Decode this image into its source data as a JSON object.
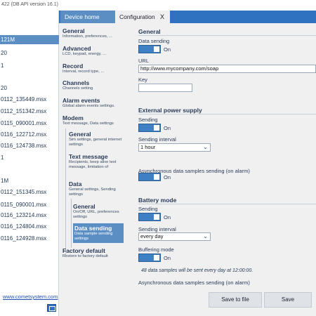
{
  "window": {
    "title": "422 (DB API version 16.1)"
  },
  "devices": [
    "121M",
    "20",
    "1",
    "20",
    "0112_135449.msx",
    "0112_151342.msx",
    "0115_090001.msx",
    "0116_122712.msx",
    "0116_124738.msx",
    "1",
    "1M",
    "0112_151345.msx",
    "0115_090001.msx",
    "0116_123214.msx",
    "0116_124804.msx",
    "0116_124928.msx"
  ],
  "website_link": "www.cometsystem.com",
  "tabs": {
    "device_home": "Device home",
    "configuration": "Configuration",
    "close": "X"
  },
  "nav": {
    "general": {
      "title": "General",
      "sub": "Information, preferences, ..."
    },
    "advanced": {
      "title": "Advanced",
      "sub": "LCD, keypad, energy, ..."
    },
    "record": {
      "title": "Record",
      "sub": "Interval, record type, ..."
    },
    "channels": {
      "title": "Channels",
      "sub": "Channels setting"
    },
    "alarm_events": {
      "title": "Alarm events",
      "sub": "Global alarm events settings."
    },
    "modem": {
      "title": "Modem",
      "sub": "Text message, Data settings"
    },
    "modem_general": {
      "title": "General",
      "sub": "Sim settings, general internet settings"
    },
    "text_message": {
      "title": "Text message",
      "sub": "Recipients, keep alive text message, limitation of"
    },
    "data": {
      "title": "Data",
      "sub": "General settings, Sending settings"
    },
    "data_general": {
      "title": "General",
      "sub": "On/Off, URL, preferences settings"
    },
    "data_sending": {
      "title": "Data sending",
      "sub": "Data sample sending settings"
    },
    "factory_default": {
      "title": "Factory default",
      "sub": "Restore to factory default"
    }
  },
  "main": {
    "general": {
      "title": "General",
      "data_sending_label": "Data sending",
      "data_sending_state": "On",
      "url_label": "URL",
      "url_value": "http://www.mycompany.com/soap",
      "key_label": "Key",
      "key_value": ""
    },
    "external": {
      "title": "External power supply",
      "sending_label": "Sending",
      "sending_state": "On",
      "interval_label": "Sending interval",
      "interval_value": "1 hour",
      "async_label": "Asynchronous data samples sending (on alarm)",
      "async_state": "On"
    },
    "battery": {
      "title": "Battery mode",
      "sending_label": "Sending",
      "sending_state": "On",
      "interval_label": "Sending interval",
      "interval_value": "every day",
      "buffering_label": "Buffering mode",
      "buffering_state": "On",
      "note": "48 data samples will be sent every day at  12:00:00.",
      "async_label": "Asynchronous data samples sending (on alarm)"
    }
  },
  "footer": {
    "save_to_file": "Save to file",
    "save": "Save"
  },
  "colors": {
    "accent": "#2f72c0",
    "selected": "#5b8fc4",
    "toggle": "#3f7fc4"
  }
}
